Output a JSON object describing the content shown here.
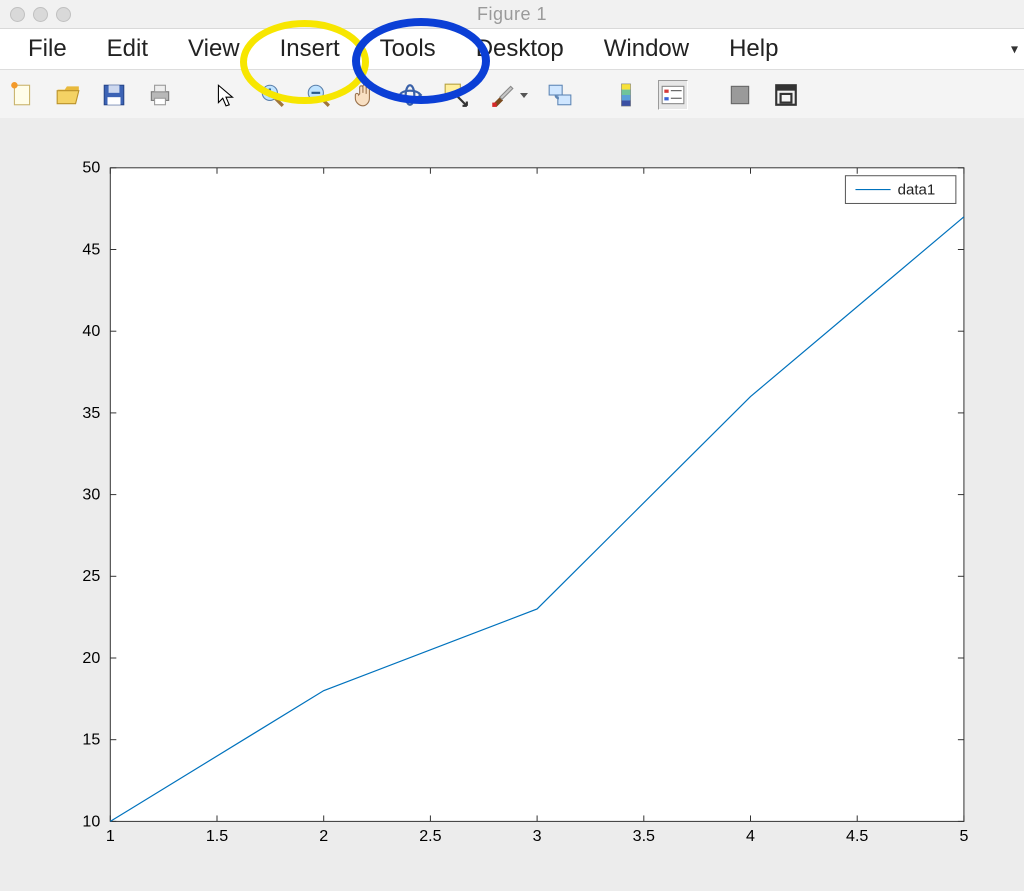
{
  "window": {
    "title": "Figure 1"
  },
  "menu": {
    "file": "File",
    "edit": "Edit",
    "view": "View",
    "insert": "Insert",
    "tools": "Tools",
    "desktop": "Desktop",
    "window": "Window",
    "help": "Help"
  },
  "toolbar_icons": {
    "new": "new-figure-icon",
    "open": "open-icon",
    "save": "save-icon",
    "print": "print-icon",
    "pointer": "edit-plot-icon",
    "zoom_in": "zoom-in-icon",
    "zoom_out": "zoom-out-icon",
    "pan": "pan-icon",
    "rotate": "rotate-3d-icon",
    "data_cursor": "data-cursor-icon",
    "brush": "brush-icon",
    "link": "link-plots-icon",
    "colorbar": "insert-colorbar-icon",
    "legend": "insert-legend-icon",
    "hide_tools": "hide-plot-tools-icon",
    "dock": "dock-figure-icon"
  },
  "annotations": {
    "yellow_circle_target": "Insert",
    "blue_circle_target": "Tools"
  },
  "colors": {
    "line": "#0072BD",
    "axes": "#333333",
    "bg": "#ececec",
    "plotbg": "#ffffff",
    "yellow": "#f7e600",
    "blue": "#0b3fd6"
  },
  "chart_data": {
    "type": "line",
    "series": [
      {
        "name": "data1",
        "x": [
          1,
          2,
          3,
          4,
          5
        ],
        "y": [
          10,
          18,
          23,
          36,
          47
        ]
      }
    ],
    "xlim": [
      1,
      5
    ],
    "ylim": [
      10,
      50
    ],
    "xticks": [
      1,
      1.5,
      2,
      2.5,
      3,
      3.5,
      4,
      4.5,
      5
    ],
    "yticks": [
      10,
      15,
      20,
      25,
      30,
      35,
      40,
      45,
      50
    ],
    "legend": {
      "entries": [
        "data1"
      ],
      "position": "northeast"
    },
    "title": "",
    "xlabel": "",
    "ylabel": ""
  }
}
